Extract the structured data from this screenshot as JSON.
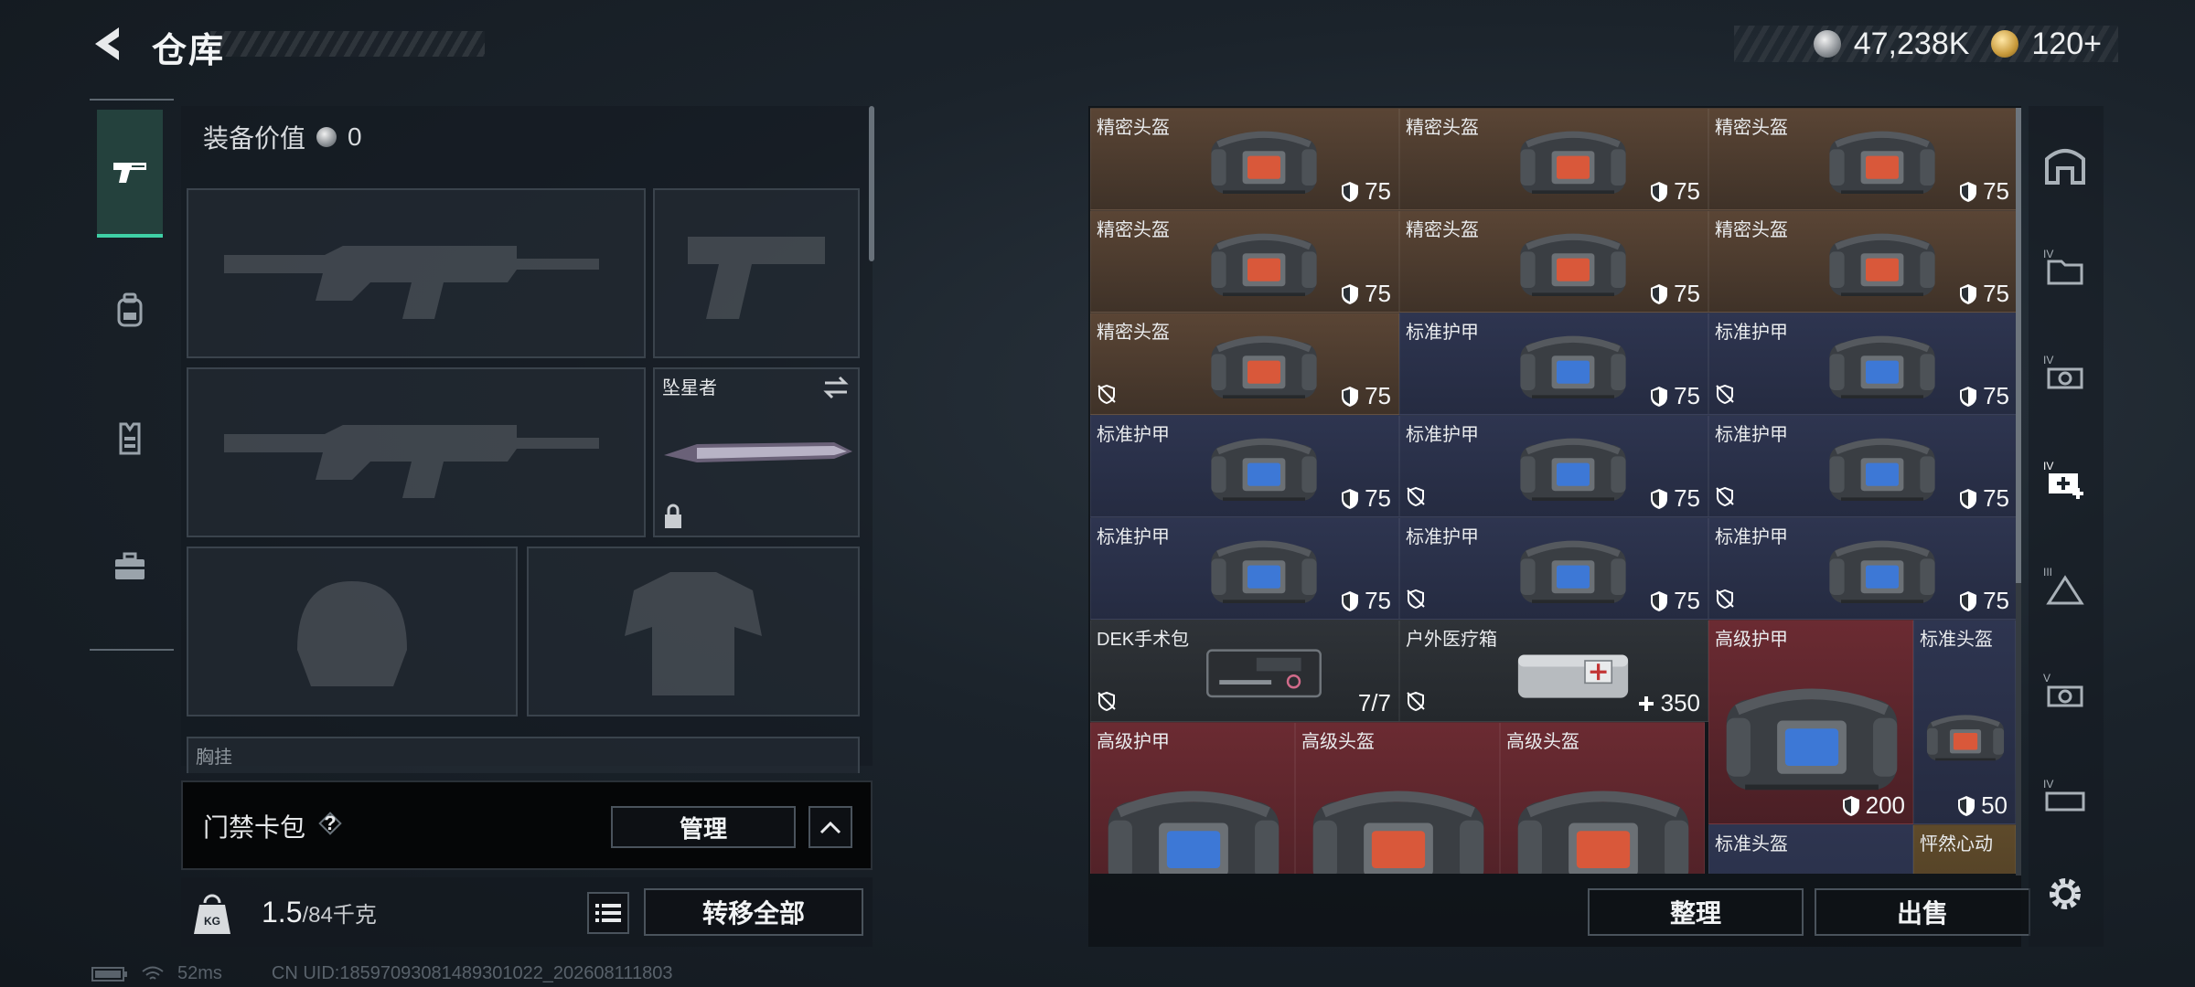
{
  "header": {
    "title": "仓库"
  },
  "currency": {
    "silver": "47,238K",
    "gold": "120+"
  },
  "loadout": {
    "gear_value_label": "装备价值",
    "gear_value": "0",
    "melee_name": "坠星者",
    "chest_rig_label": "胸挂",
    "keycard_label": "门禁卡包",
    "manage_label": "管理",
    "weight_value": "1.5",
    "weight_capacity": "/84千克",
    "weight_unit_icon": "KG",
    "transfer_all_label": "转移全部"
  },
  "stash": {
    "items": [
      {
        "name": "精密头盔",
        "value": "75",
        "tier": "brown",
        "kind": "helmet",
        "durability_icon": "shield"
      },
      {
        "name": "精密头盔",
        "value": "75",
        "tier": "brown",
        "kind": "helmet",
        "durability_icon": "shield"
      },
      {
        "name": "精密头盔",
        "value": "75",
        "tier": "brown",
        "kind": "helmet",
        "durability_icon": "shield"
      },
      {
        "name": "精密头盔",
        "value": "75",
        "tier": "brown",
        "kind": "helmet",
        "durability_icon": "shield"
      },
      {
        "name": "精密头盔",
        "value": "75",
        "tier": "brown",
        "kind": "helmet",
        "durability_icon": "shield"
      },
      {
        "name": "精密头盔",
        "value": "75",
        "tier": "brown",
        "kind": "helmet",
        "durability_icon": "shield"
      },
      {
        "name": "精密头盔",
        "value": "75",
        "tier": "brown",
        "kind": "helmet",
        "durability_icon": "shield"
      },
      {
        "name": "标准护甲",
        "value": "75",
        "tier": "navy",
        "kind": "armor",
        "durability_icon": "shield"
      },
      {
        "name": "标准护甲",
        "value": "75",
        "tier": "navy",
        "kind": "armor",
        "durability_icon": "shield"
      },
      {
        "name": "标准护甲",
        "value": "75",
        "tier": "navy",
        "kind": "armor",
        "durability_icon": "shield"
      },
      {
        "name": "标准护甲",
        "value": "75",
        "tier": "navy",
        "kind": "armor",
        "durability_icon": "shield"
      },
      {
        "name": "标准护甲",
        "value": "75",
        "tier": "navy",
        "kind": "armor",
        "durability_icon": "shield"
      },
      {
        "name": "标准护甲",
        "value": "75",
        "tier": "navy",
        "kind": "armor",
        "durability_icon": "shield"
      },
      {
        "name": "标准护甲",
        "value": "75",
        "tier": "navy",
        "kind": "armor",
        "durability_icon": "shield"
      },
      {
        "name": "标准护甲",
        "value": "75",
        "tier": "navy",
        "kind": "armor",
        "durability_icon": "shield"
      },
      {
        "name": "DEK手术包",
        "value": "7/7",
        "tier": "dark",
        "kind": "kit",
        "durability_icon": "none"
      },
      {
        "name": "户外医疗箱",
        "value": "350",
        "tier": "dark",
        "kind": "medbox",
        "durability_icon": "plus"
      },
      {
        "name": "高级护甲",
        "value": "200",
        "tier": "red",
        "kind": "armor",
        "durability_icon": "shield"
      },
      {
        "name": "标准头盔",
        "value": "50",
        "tier": "navy",
        "kind": "helmet",
        "durability_icon": "shield"
      },
      {
        "name": "高级护甲",
        "value": "",
        "tier": "red",
        "kind": "armor",
        "durability_icon": "none"
      },
      {
        "name": "高级头盔",
        "value": "",
        "tier": "red",
        "kind": "helmet",
        "durability_icon": "none"
      },
      {
        "name": "高级头盔",
        "value": "",
        "tier": "red",
        "kind": "helmet",
        "durability_icon": "none"
      },
      {
        "name": "标准头盔",
        "value": "",
        "tier": "navy",
        "kind": "helmet",
        "durability_icon": "none"
      },
      {
        "name": "怦然心动",
        "value": "",
        "tier": "gold",
        "kind": "misc",
        "durability_icon": "none"
      }
    ],
    "sort_label": "整理",
    "sell_label": "出售"
  },
  "status": {
    "ping": "52ms",
    "uid": "CN UID:18597093081489301022_202608111803"
  },
  "icons": {
    "back": "back-arrow-icon",
    "tabs": [
      "pistol-icon",
      "backpack-icon",
      "vest-icon",
      "toolbox-icon"
    ],
    "right": [
      "home-icon",
      "folder-tier4-icon",
      "car-tier4-icon",
      "medkit-tier4-icon",
      "triangle-tier3-icon",
      "car-tier5-icon",
      "crate-tier4-icon",
      "gear-icon"
    ]
  },
  "colors": {
    "accent": "#3fd0a6",
    "brown_tier": "#5a4535",
    "navy_tier": "#2e3550",
    "red_tier": "#6b2b32"
  }
}
